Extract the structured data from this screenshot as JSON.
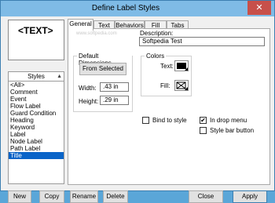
{
  "window": {
    "title": "Define Label Styles",
    "close_glyph": "✕"
  },
  "preview": {
    "text": "<TEXT>"
  },
  "styles": {
    "header": "Styles",
    "items": [
      "<All>",
      "Comment",
      "Event",
      "Flow Label",
      "Guard Condition",
      "Heading",
      "Keyword",
      "Label",
      "Node Label",
      "Path Label",
      "Title"
    ],
    "selected": "Title"
  },
  "tabs": [
    "General",
    "Text",
    "Behaviors",
    "Fill",
    "Tabs"
  ],
  "active_tab": "General",
  "general": {
    "watermark": "www.softpedia.com",
    "description_label": "Description:",
    "description_value": "Softpedia Test",
    "default_dimensions_label": "Default Dimensions",
    "from_selected_label": "From Selected",
    "width_label": "Width:",
    "width_value": ".43 in",
    "height_label": "Height:",
    "height_value": ".29 in",
    "colors_label": "Colors",
    "text_color_label": "Text:",
    "fill_color_label": "Fill:",
    "bind_to_style_label": "Bind to style",
    "bind_to_style_checked": false,
    "in_drop_menu_label": "In drop menu",
    "in_drop_menu_checked": true,
    "style_bar_button_label": "Style bar button",
    "style_bar_button_checked": false
  },
  "buttons": {
    "new": "New",
    "copy": "Copy",
    "rename": "Rename",
    "delete": "Delete",
    "close": "Close",
    "apply": "Apply"
  },
  "colors": {
    "title_bar": "#7fbbe6",
    "close_button": "#c7504a",
    "selection": "#0a64c8",
    "text_color": "#000000"
  }
}
